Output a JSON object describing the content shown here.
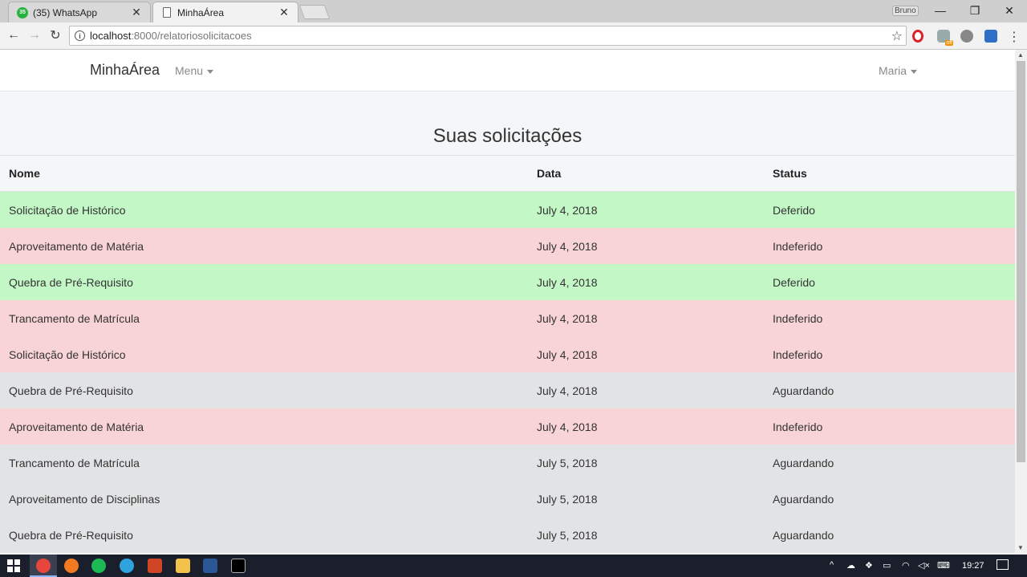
{
  "browser": {
    "tabs": [
      {
        "title": "(35) WhatsApp",
        "badge": "35",
        "icon": "whatsapp-icon"
      },
      {
        "title": "MinhaÁrea",
        "icon": "document-icon"
      }
    ],
    "profile": "Bruno",
    "url_host": "localhost",
    "url_path": ":8000/relatoriosolicitacoes",
    "ext_off_label": "off"
  },
  "navbar": {
    "brand": "MinhaÁrea",
    "menu": "Menu",
    "user": "Maria"
  },
  "page": {
    "title": "Suas solicitações"
  },
  "table": {
    "headers": {
      "nome": "Nome",
      "data": "Data",
      "status": "Status"
    },
    "rows": [
      {
        "nome": "Solicitação de Histórico",
        "data": "July 4, 2018",
        "status": "Deferido"
      },
      {
        "nome": "Aproveitamento de Matéria",
        "data": "July 4, 2018",
        "status": "Indeferido"
      },
      {
        "nome": "Quebra de Pré-Requisito",
        "data": "July 4, 2018",
        "status": "Deferido"
      },
      {
        "nome": "Trancamento de Matrícula",
        "data": "July 4, 2018",
        "status": "Indeferido"
      },
      {
        "nome": "Solicitação de Histórico",
        "data": "July 4, 2018",
        "status": "Indeferido"
      },
      {
        "nome": "Quebra de Pré-Requisito",
        "data": "July 4, 2018",
        "status": "Aguardando"
      },
      {
        "nome": "Aproveitamento de Matéria",
        "data": "July 4, 2018",
        "status": "Indeferido"
      },
      {
        "nome": "Trancamento de Matrícula",
        "data": "July 5, 2018",
        "status": "Aguardando"
      },
      {
        "nome": "Aproveitamento de Disciplinas",
        "data": "July 5, 2018",
        "status": "Aguardando"
      },
      {
        "nome": "Quebra de Pré-Requisito",
        "data": "July 5, 2018",
        "status": "Aguardando"
      }
    ]
  },
  "colors": {
    "deferido": "#c3f7c6",
    "indeferido": "#f9d4d6",
    "aguardando": "#e2e3e5"
  },
  "taskbar": {
    "clock": "19:27",
    "apps": [
      "windows-start-icon",
      "chrome-icon",
      "firefox-icon",
      "spotify-icon",
      "telegram-icon",
      "powerpoint-icon",
      "file-explorer-icon",
      "word-icon",
      "terminal-icon"
    ]
  }
}
